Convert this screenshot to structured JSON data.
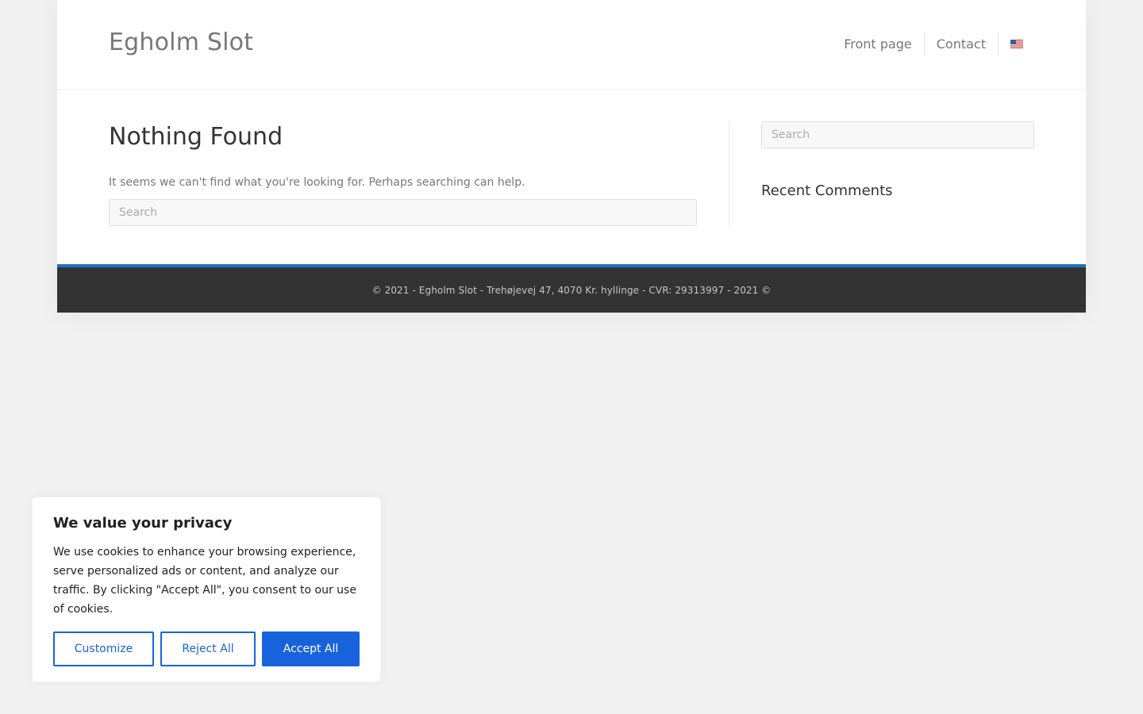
{
  "header": {
    "site_title": "Egholm Slot",
    "nav": {
      "items": [
        {
          "label": "Front page"
        },
        {
          "label": "Contact"
        }
      ],
      "language_flag": "us-flag-icon"
    }
  },
  "main": {
    "title": "Nothing Found",
    "message": "It seems we can't find what you're looking for. Perhaps searching can help.",
    "search": {
      "placeholder": "Search",
      "value": ""
    }
  },
  "sidebar": {
    "search": {
      "placeholder": "Search",
      "value": ""
    },
    "widget_title": "Recent Comments"
  },
  "footer": {
    "text": "© 2021 - Egholm Slot - Trehøjevej 47, 4070 Kr. hyllinge - CVR: 29313997 - 2021 ©",
    "accent_color": "#1e73be"
  },
  "cookie_banner": {
    "title": "We value your privacy",
    "text": "We use cookies to enhance your browsing experience, serve personalized ads or content, and analyze our traffic. By clicking \"Accept All\", you consent to our use of cookies.",
    "buttons": {
      "customize": "Customize",
      "reject": "Reject All",
      "accept": "Accept All"
    },
    "accent_color": "#1863dc"
  }
}
